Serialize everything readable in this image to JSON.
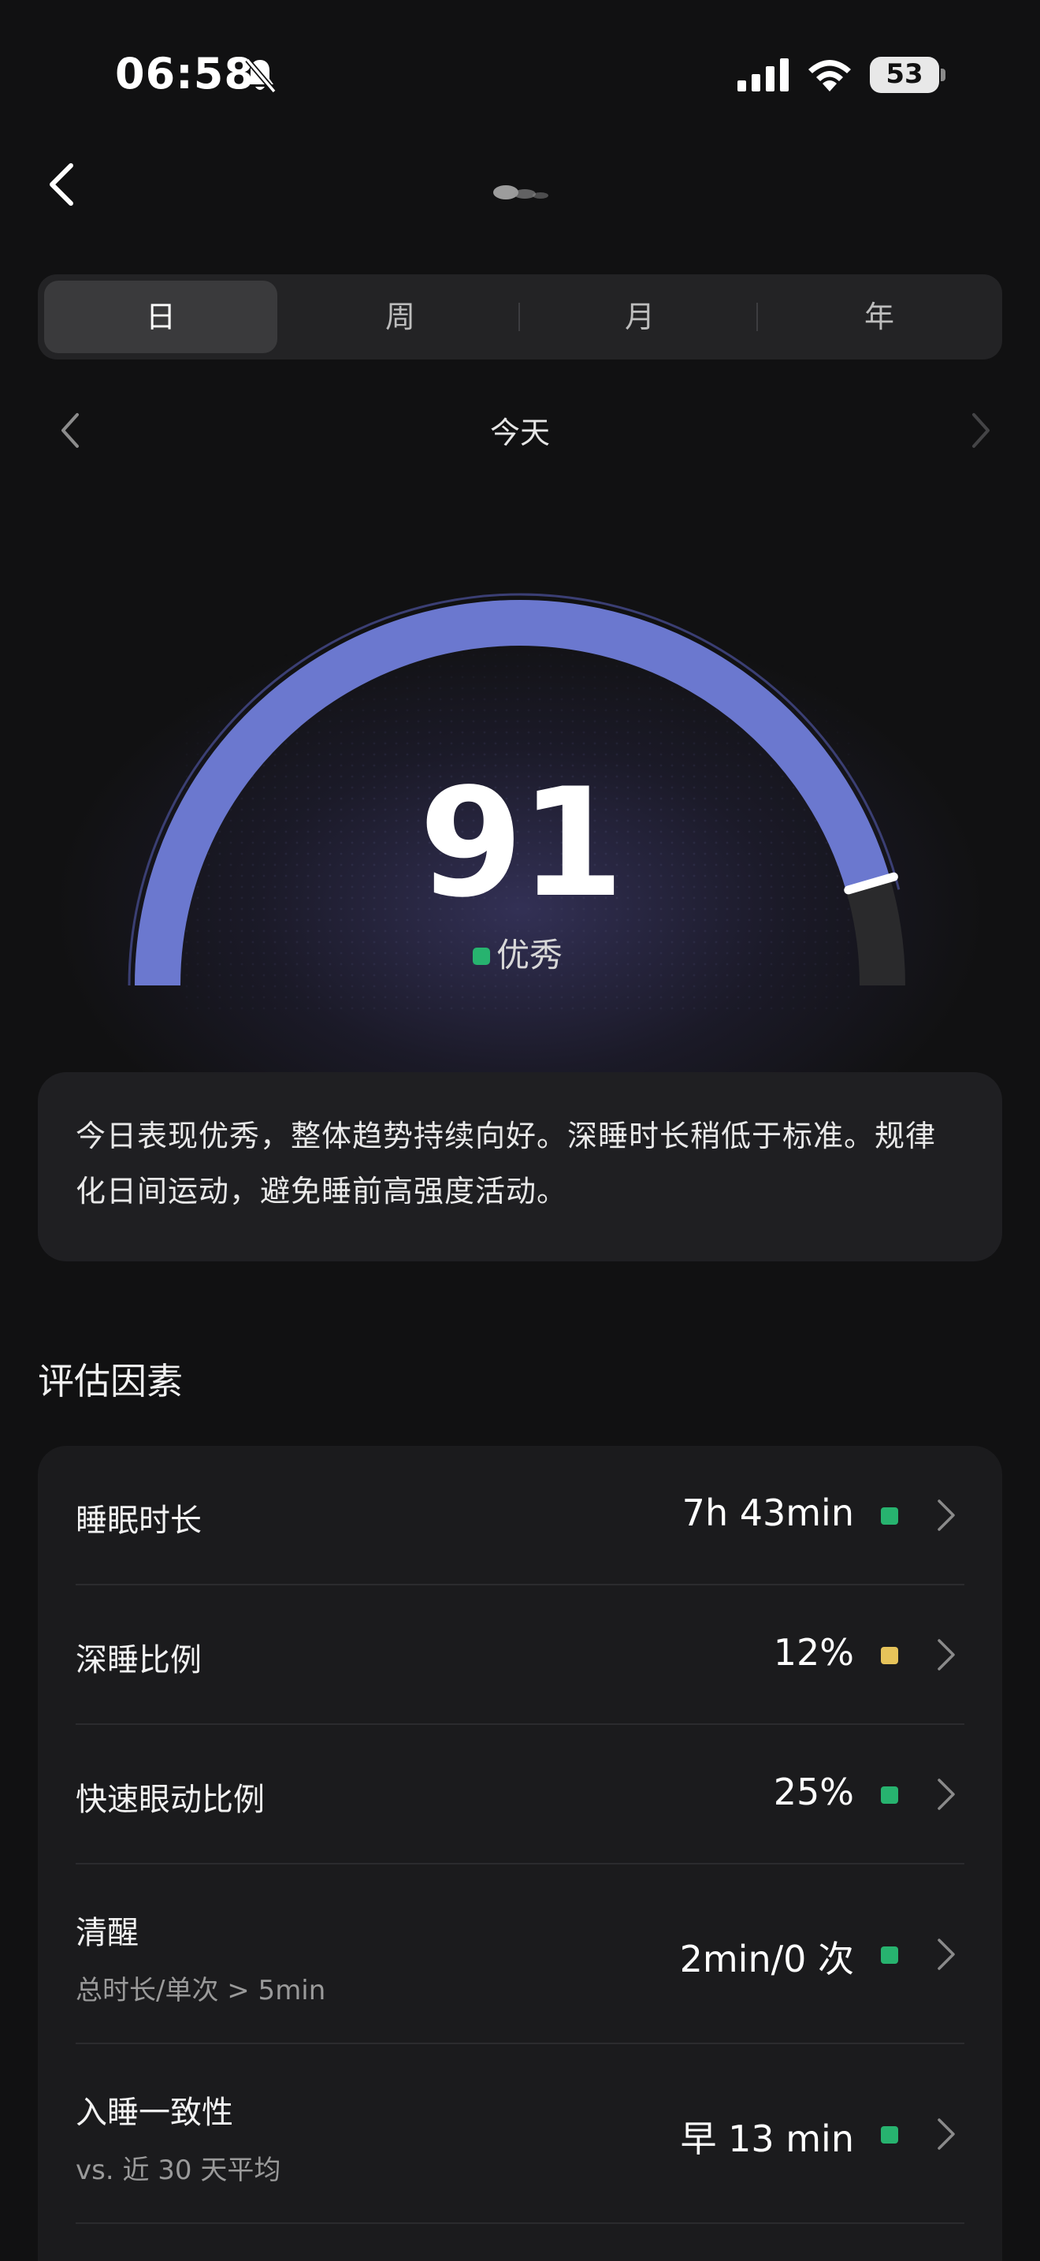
{
  "status_bar": {
    "time": "06:58",
    "battery": "53",
    "icons": [
      "bell-slash-icon",
      "cellular-signal-icon",
      "wifi-icon",
      "battery-icon"
    ]
  },
  "header": {
    "back_icon": "chevron-left-icon"
  },
  "tabs": [
    {
      "label": "日",
      "active": true
    },
    {
      "label": "周",
      "active": false
    },
    {
      "label": "月",
      "active": false
    },
    {
      "label": "年",
      "active": false
    }
  ],
  "date_nav": {
    "label": "今天",
    "prev_icon": "chevron-left-icon",
    "next_icon": "chevron-right-icon"
  },
  "score": {
    "value": "91",
    "max": 100,
    "grade": "优秀",
    "grade_color": "#27b36f",
    "arc_color": "#6b78cf"
  },
  "summary": {
    "text": "今日表现优秀，整体趋势持续向好。深睡时长稍低于标准。规律化日间运动，避免睡前高强度活动。"
  },
  "factors": {
    "title": "评估因素",
    "rows": [
      {
        "label": "睡眠时长",
        "value": "7h 43min",
        "indicator": "#27b36f"
      },
      {
        "label": "深睡比例",
        "value": "12%",
        "indicator": "#e6c35a"
      },
      {
        "label": "快速眼动比例",
        "value": "25%",
        "indicator": "#27b36f"
      },
      {
        "label": "清醒",
        "sub": "总时长/单次 > 5min",
        "value": "2min/0 次",
        "indicator": "#27b36f"
      },
      {
        "label": "入睡一致性",
        "sub": "vs. 近 30 天平均",
        "value": "早 13 min",
        "indicator": "#27b36f"
      }
    ]
  }
}
